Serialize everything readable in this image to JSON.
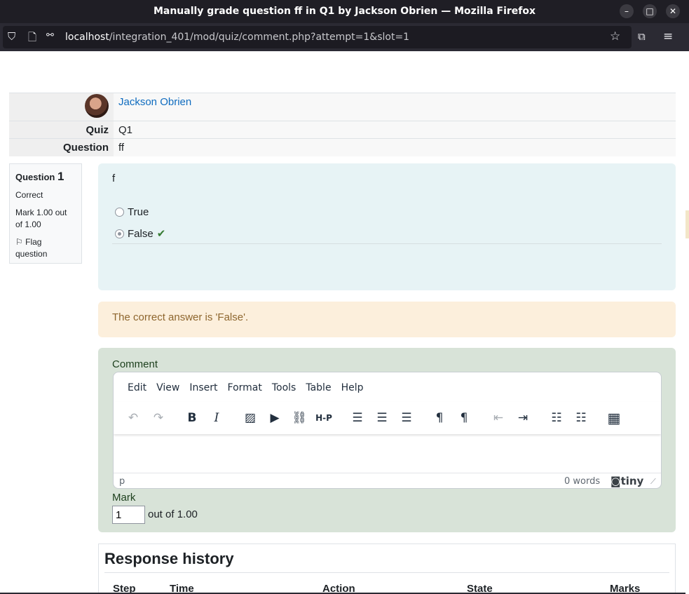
{
  "browser": {
    "window_title": "Manually grade question ff in Q1 by Jackson Obrien — Mozilla Firefox",
    "url_host": "localhost",
    "url_path": "/integration_401/mod/quiz/comment.php?attempt=1&slot=1"
  },
  "info": {
    "user_name": "Jackson Obrien",
    "quiz_label": "Quiz",
    "quiz_value": "Q1",
    "question_label": "Question",
    "question_value": "ff"
  },
  "qinfo": {
    "prefix": "Question",
    "number": "1",
    "state": "Correct",
    "mark": "Mark 1.00 out of 1.00",
    "flag": "Flag question"
  },
  "question": {
    "text": "f",
    "options": [
      {
        "label": "True",
        "checked": false
      },
      {
        "label": "False",
        "checked": true
      }
    ]
  },
  "feedback": {
    "text": "The correct answer is 'False'."
  },
  "comment": {
    "label": "Comment",
    "menu": [
      "Edit",
      "View",
      "Insert",
      "Format",
      "Tools",
      "Table",
      "Help"
    ],
    "status_path": "p",
    "word_count": "0 words",
    "brand": "tiny"
  },
  "mark": {
    "label": "Mark",
    "value": "1",
    "out_of": "out of 1.00"
  },
  "history": {
    "title": "Response history",
    "columns": [
      "Step",
      "Time",
      "Action",
      "State",
      "Marks"
    ]
  }
}
